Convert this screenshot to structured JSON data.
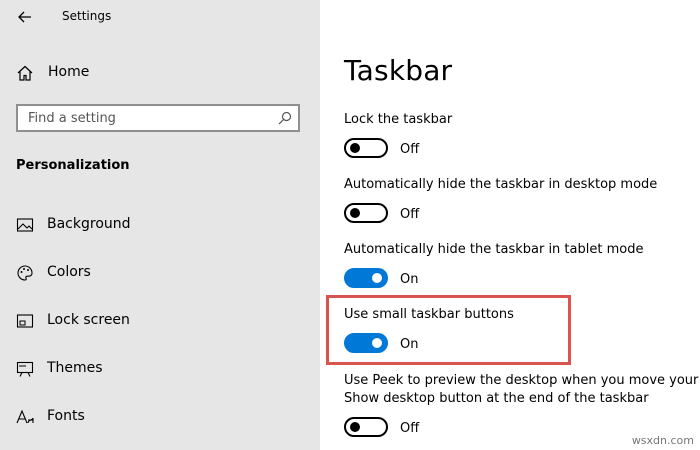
{
  "window": {
    "title": "Settings"
  },
  "sidebar": {
    "home_label": "Home",
    "search_placeholder": "Find a setting",
    "section_heading": "Personalization",
    "items": [
      {
        "label": "Background",
        "icon": "image-icon"
      },
      {
        "label": "Colors",
        "icon": "palette-icon"
      },
      {
        "label": "Lock screen",
        "icon": "lock-screen-icon"
      },
      {
        "label": "Themes",
        "icon": "themes-icon"
      },
      {
        "label": "Fonts",
        "icon": "fonts-icon"
      }
    ]
  },
  "main": {
    "title": "Taskbar",
    "settings": [
      {
        "label": "Lock the taskbar",
        "state": "Off",
        "on": false
      },
      {
        "label": "Automatically hide the taskbar in desktop mode",
        "state": "Off",
        "on": false
      },
      {
        "label": "Automatically hide the taskbar in tablet mode",
        "state": "On",
        "on": true
      },
      {
        "label": "Use small taskbar buttons",
        "state": "On",
        "on": true
      },
      {
        "label": "Use Peek to preview the desktop when you move your mo",
        "label2": "Show desktop button at the end of the taskbar",
        "state": "Off",
        "on": false
      }
    ]
  },
  "colors": {
    "accent": "#0078d7",
    "sidebar_bg": "#e6e6e6",
    "highlight": "#d9534f"
  },
  "watermark": "wsxdn.com"
}
